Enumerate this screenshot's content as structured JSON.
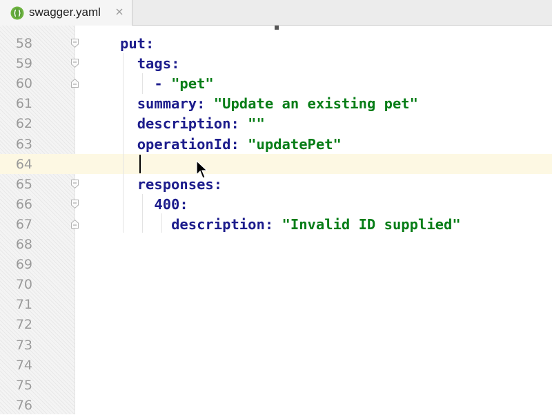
{
  "tab": {
    "title": "swagger.yaml",
    "icon": "swagger-icon",
    "close_icon": "close-icon",
    "accent": "#5da13a"
  },
  "editor": {
    "current_line": 64,
    "colors": {
      "key": "#1c1c8c",
      "string": "#067d17",
      "line_number": "#9a9a9a",
      "current_line_bg": "#fdf8e3"
    },
    "lines": [
      {
        "num": "58",
        "key": "put",
        "punc": ":",
        "str": "",
        "indent": ""
      },
      {
        "num": "59",
        "key": "tags",
        "punc": ":",
        "str": "",
        "indent": "  "
      },
      {
        "num": "60",
        "dash": "- ",
        "str": "\"pet\"",
        "indent": "    "
      },
      {
        "num": "61",
        "key": "summary",
        "punc": ": ",
        "str": "\"Update an existing pet\"",
        "indent": "  "
      },
      {
        "num": "62",
        "key": "description",
        "punc": ": ",
        "str": "\"\"",
        "indent": "  "
      },
      {
        "num": "63",
        "key": "operationId",
        "punc": ": ",
        "str": "\"updatePet\"",
        "indent": "  "
      },
      {
        "num": "64",
        "indent": ""
      },
      {
        "num": "65",
        "key": "responses",
        "punc": ":",
        "indent": "  "
      },
      {
        "num": "66",
        "key": "400",
        "punc": ":",
        "indent": "    "
      },
      {
        "num": "67",
        "key": "description",
        "punc": ": ",
        "str": "\"Invalid ID supplied\"",
        "indent": "      "
      },
      {
        "num": "68"
      },
      {
        "num": "69"
      },
      {
        "num": "70"
      },
      {
        "num": "71"
      },
      {
        "num": "72"
      },
      {
        "num": "73"
      },
      {
        "num": "74"
      },
      {
        "num": "75"
      },
      {
        "num": "76"
      }
    ]
  }
}
